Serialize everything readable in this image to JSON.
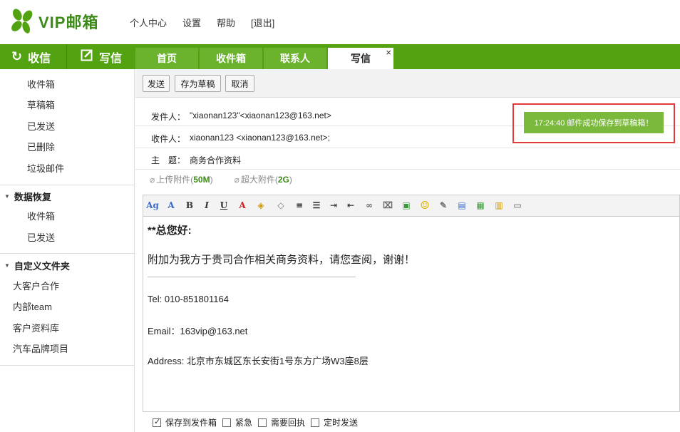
{
  "header": {
    "logo_text": "VIP邮箱",
    "links": [
      "个人中心",
      "设置",
      "帮助",
      "[退出]"
    ]
  },
  "nav": {
    "receive_label": "收信",
    "compose_label": "写信",
    "tabs": [
      "首页",
      "收件箱",
      "联系人",
      "写信"
    ],
    "active_tab": "写信",
    "close_icon": "×"
  },
  "sidebar": {
    "mail_folders": [
      "收件箱",
      "草稿箱",
      "已发送",
      "已删除",
      "垃圾邮件"
    ],
    "recovery": {
      "title": "数据恢复",
      "items": [
        "收件箱",
        "已发送"
      ]
    },
    "custom": {
      "title": "自定义文件夹",
      "items": [
        "大客户合作",
        "内部team",
        "客户资料库",
        "汽车品牌项目"
      ]
    }
  },
  "toolbar": {
    "send": "发送",
    "save_draft": "存为草稿",
    "cancel": "取消"
  },
  "compose": {
    "from_label": "发件人：",
    "from_value": "\"xiaonan123\"<xiaonan123@163.net>",
    "to_label": "收件人：",
    "to_value": "xiaonan123 <xiaonan123@163.net>;",
    "subject_label": "主　题：",
    "subject_value": "商务合作资料",
    "attach_label": "上传附件",
    "attach_size": "50M",
    "big_attach_label": "超大附件",
    "big_attach_size": "2G"
  },
  "notice": "17:24:40 邮件成功保存到草稿箱！",
  "body": {
    "greeting": "**总您好:",
    "paragraph": "附加为我方于贵司合作相关商务资料，请您查阅，谢谢！",
    "tel": "Tel: 010-851801164",
    "email": "Email：163vip@163.net",
    "address": "Address: 北京市东城区东长安街1号东方广场W3座8层"
  },
  "options": [
    {
      "label": "保存到发件箱",
      "checked": true
    },
    {
      "label": "紧急",
      "checked": false
    },
    {
      "label": "需要回执",
      "checked": false
    },
    {
      "label": "定时发送",
      "checked": false
    }
  ],
  "colors": {
    "brand_green": "#52a211",
    "tab_green": "#6bb22d",
    "notice_green": "#7ab93b",
    "highlight_red": "#e03a3a"
  }
}
